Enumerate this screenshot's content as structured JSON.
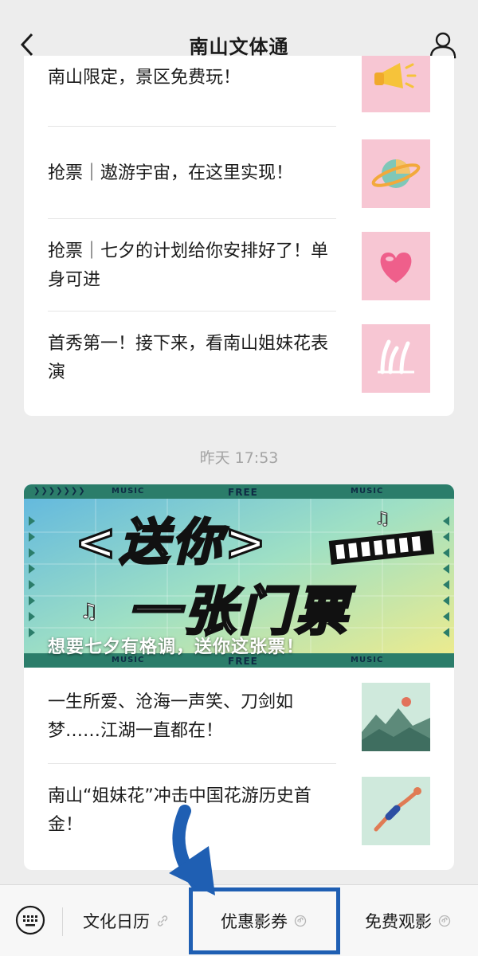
{
  "header": {
    "title": "南山文体通"
  },
  "articles_top": [
    {
      "title": "南山限定，景区免费玩！",
      "thumb": "megaphone-thumbnail"
    },
    {
      "title": "抢票｜遨游宇宙，在这里实现！",
      "thumb": "planet-thumbnail"
    },
    {
      "title": "抢票｜七夕的计划给你安排好了！单身可进",
      "thumb": "heart-thumbnail"
    },
    {
      "title": "首秀第一！接下来，看南山姐妹花表演",
      "thumb": "swimmers-thumbnail"
    }
  ],
  "timestamp": "昨天 17:53",
  "banner": {
    "caption": "想要七夕有格调，送你这张票！",
    "line1": "<送你>",
    "line2": "一张门票",
    "tag_music": "MUSIC",
    "tag_free": "FREE",
    "arrows": "❯❯❯❯❯❯❯"
  },
  "articles_bottom": [
    {
      "title": "一生所爱、沧海一声笑、刀剑如梦……江湖一直都在！",
      "thumb": "landscape-thumbnail"
    },
    {
      "title": "南山“姐妹花”冲击中国花游历史首金！",
      "thumb": "diver-thumbnail"
    }
  ],
  "menu": {
    "items": [
      {
        "label": "文化日历"
      },
      {
        "label": "优惠影券"
      },
      {
        "label": "免费观影"
      }
    ]
  },
  "colors": {
    "accent_blue": "#1f5fb3",
    "thumb_pink": "#f7c6d3",
    "thumb_green": "#cfe9dc"
  }
}
